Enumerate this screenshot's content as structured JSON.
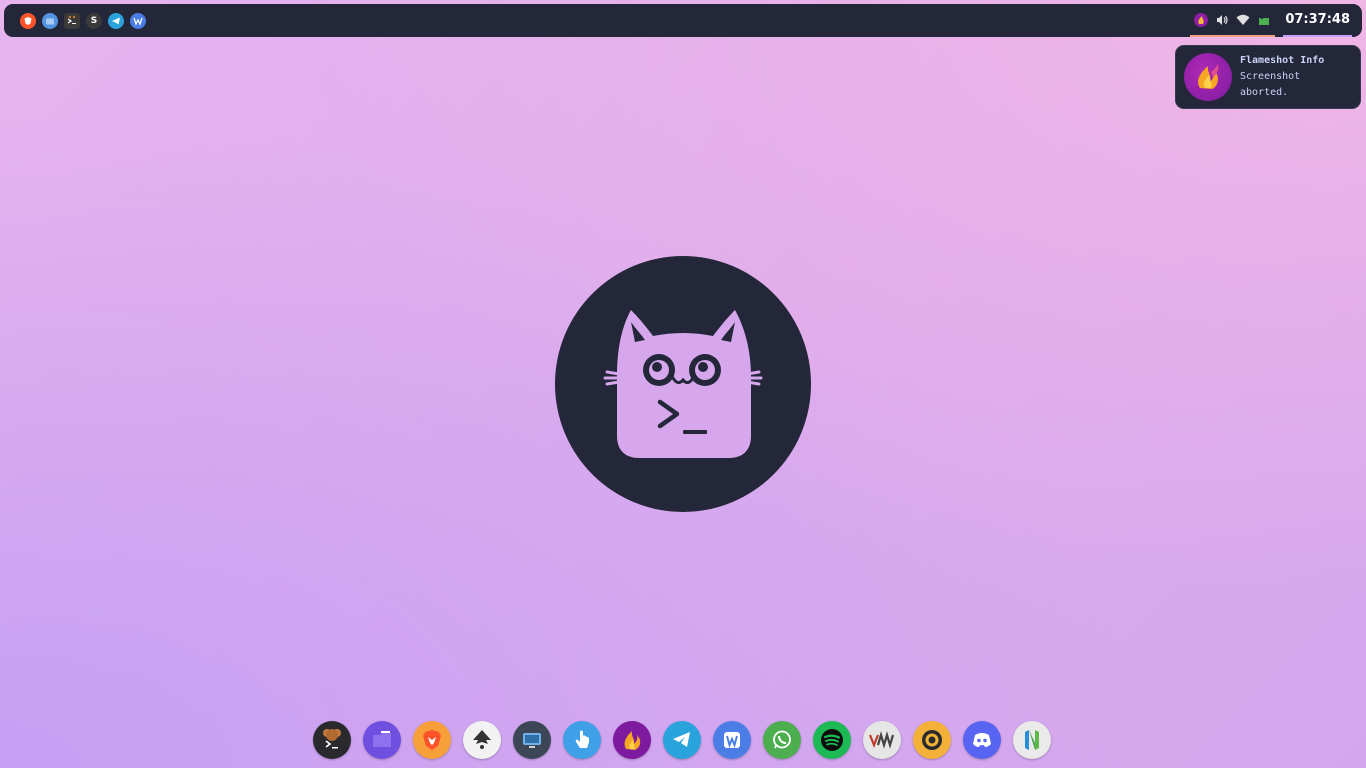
{
  "topbar": {
    "left_apps": [
      {
        "name": "brave",
        "color": "#fb542b"
      },
      {
        "name": "files",
        "color": "#5294e2"
      },
      {
        "name": "terminal",
        "color": "#3a3a3a"
      },
      {
        "name": "s-app",
        "glyph": "S",
        "color": "#3a3a3a"
      },
      {
        "name": "telegram",
        "color": "#2aa3dd"
      },
      {
        "name": "wps-writer",
        "color": "#4a7ee6"
      }
    ],
    "clock": "07:37:48"
  },
  "notification": {
    "title": "Flameshot Info",
    "body": "Screenshot aborted."
  },
  "dock": {
    "items": [
      {
        "name": "terminal",
        "color": "#2a2a2e"
      },
      {
        "name": "files",
        "color": "#6f4fe0"
      },
      {
        "name": "brave",
        "color": "#f7a03a"
      },
      {
        "name": "inkscape",
        "color": "#f2f2f2"
      },
      {
        "name": "remote-desktop",
        "color": "#3c4656"
      },
      {
        "name": "touchegg",
        "color": "#3fa0e8"
      },
      {
        "name": "flameshot",
        "color": "#7d1aa0"
      },
      {
        "name": "telegram",
        "color": "#2aa3dd"
      },
      {
        "name": "wps-writer",
        "color": "#4a7ee6"
      },
      {
        "name": "whatsapp",
        "color": "#4cae4f"
      },
      {
        "name": "spotify",
        "color": "#1db954"
      },
      {
        "name": "virt-manager",
        "color": "#e6e6e6"
      },
      {
        "name": "obs",
        "color": "#f3b13a"
      },
      {
        "name": "discord",
        "color": "#5865f2"
      },
      {
        "name": "neovim",
        "color": "#eaeaea"
      }
    ]
  },
  "colors": {
    "bar_bg": "#24273a",
    "accent": "#c6a0f6",
    "peach": "#f0a080",
    "text": "#cad3f5"
  }
}
